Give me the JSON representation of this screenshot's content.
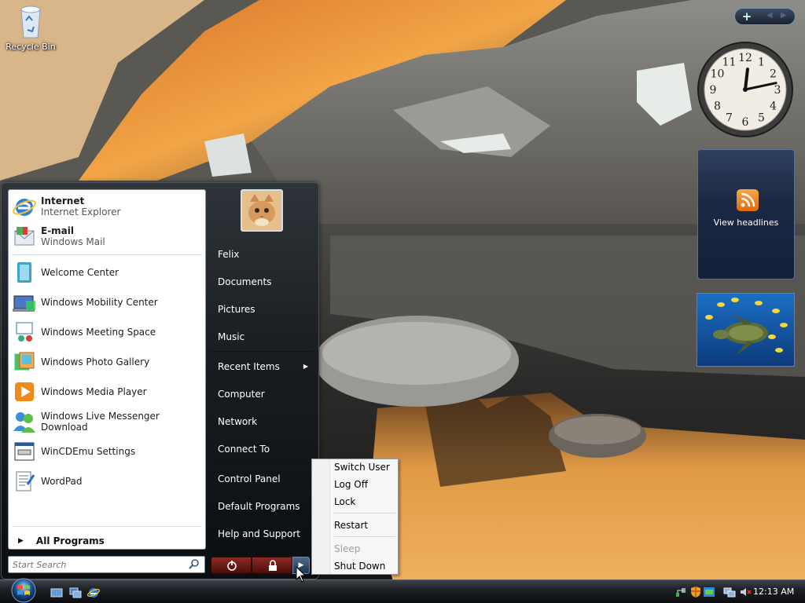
{
  "desktop": {
    "recycle_bin_label": "Recycle Bin",
    "icon": "recycle-bin-icon"
  },
  "gadgets": {
    "toolbar_add": "+",
    "clock": {
      "hour": 12,
      "minute": 13,
      "numbers": [
        "12",
        "1",
        "2",
        "3",
        "4",
        "5",
        "6",
        "7",
        "8",
        "9",
        "10",
        "11"
      ]
    },
    "feed_label": "View headlines",
    "slideshow": "sea-turtle-photo"
  },
  "start_menu": {
    "pinned": [
      {
        "title": "Internet",
        "subtitle": "Internet Explorer",
        "icon": "internet-explorer-icon"
      },
      {
        "title": "E-mail",
        "subtitle": "Windows Mail",
        "icon": "windows-mail-icon"
      }
    ],
    "recent": [
      {
        "label": "Welcome Center",
        "icon": "welcome-center-icon"
      },
      {
        "label": "Windows Mobility Center",
        "icon": "mobility-center-icon"
      },
      {
        "label": "Windows Meeting Space",
        "icon": "meeting-space-icon"
      },
      {
        "label": "Windows Photo Gallery",
        "icon": "photo-gallery-icon"
      },
      {
        "label": "Windows Media Player",
        "icon": "media-player-icon"
      },
      {
        "label": "Windows Live Messenger Download",
        "icon": "messenger-icon"
      },
      {
        "label": "WinCDEmu Settings",
        "icon": "wincdemu-icon"
      },
      {
        "label": "WordPad",
        "icon": "wordpad-icon"
      }
    ],
    "all_programs": "All Programs",
    "search_placeholder": "Start Search",
    "user_picture": "kitten-user-picture",
    "right_items": {
      "user": "Felix",
      "documents": "Documents",
      "pictures": "Pictures",
      "music": "Music",
      "recent_items": "Recent Items",
      "computer": "Computer",
      "network": "Network",
      "connect_to": "Connect To",
      "control_panel": "Control Panel",
      "default_programs": "Default Programs",
      "help": "Help and Support"
    }
  },
  "power_menu": {
    "switch_user": "Switch User",
    "log_off": "Log Off",
    "lock": "Lock",
    "restart": "Restart",
    "sleep": "Sleep",
    "shut_down": "Shut Down"
  },
  "taskbar": {
    "time": "12:13 AM",
    "quick_launch": [
      "show-desktop-icon",
      "switch-windows-icon",
      "internet-explorer-icon"
    ],
    "tray": [
      "network-icon",
      "security-shield-icon",
      "windows-defender-icon",
      "network-connection-icon",
      "volume-muted-icon"
    ]
  }
}
